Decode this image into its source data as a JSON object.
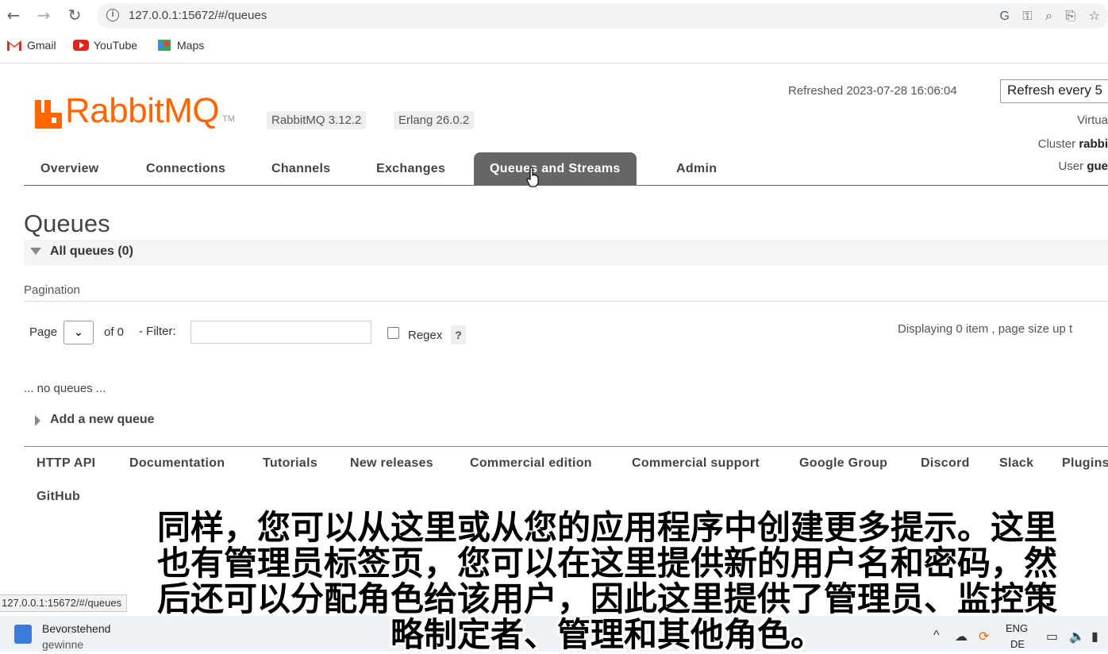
{
  "browser": {
    "url": "127.0.0.1:15672/#/queues",
    "bookmarks": [
      {
        "label": "Gmail"
      },
      {
        "label": "YouTube"
      },
      {
        "label": "Maps"
      }
    ]
  },
  "header": {
    "brand": "RabbitMQ",
    "tm": "TM",
    "version_badge": "RabbitMQ 3.12.2",
    "erlang_badge": "Erlang 26.0.2",
    "refreshed": "Refreshed 2023-07-28 16:06:04",
    "refresh_select": "Refresh every 5",
    "virtual_label": "Virtua",
    "cluster_label": "Cluster",
    "cluster_value": "rabbi",
    "user_label": "User",
    "user_value": "gue"
  },
  "tabs": [
    {
      "label": "Overview"
    },
    {
      "label": "Connections"
    },
    {
      "label": "Channels"
    },
    {
      "label": "Exchanges"
    },
    {
      "label": "Queues and Streams",
      "active": true
    },
    {
      "label": "Admin"
    }
  ],
  "main": {
    "title": "Queues",
    "section_label": "All queues (0)",
    "pagination_heading": "Pagination",
    "page_label": "Page",
    "of_label": "of 0",
    "filter_label": "- Filter:",
    "filter_value": "",
    "regex_label": "Regex",
    "help_label": "?",
    "displaying": "Displaying 0 item , page size up t",
    "no_queues": "... no queues ...",
    "add_queue": "Add a new queue"
  },
  "footer": {
    "links": [
      "HTTP API",
      "Documentation",
      "Tutorials",
      "New releases",
      "Commercial edition",
      "Commercial support",
      "Google Group",
      "Discord",
      "Slack",
      "Plugins",
      "GitHub"
    ]
  },
  "subtitle": {
    "line1": "同样，您可以从这里或从您的应用程序中创建更多提示。这里",
    "line2": "也有管理员标签页，您可以在这里提供新的用户名和密码，然",
    "line3": "后还可以分配角色给该用户，因此这里提供了管理员、监控策",
    "line4": "略制定者、管理和其他角色。"
  },
  "status_bar": {
    "url": "127.0.0.1:15672/#/queues"
  },
  "taskbar": {
    "weather_line1": "Bevorstehend",
    "weather_line2": "gewinne",
    "lang_line1": "ENG",
    "lang_line2": "DE"
  },
  "colors": {
    "brand_orange": "#ff6600",
    "active_tab": "#666666"
  }
}
